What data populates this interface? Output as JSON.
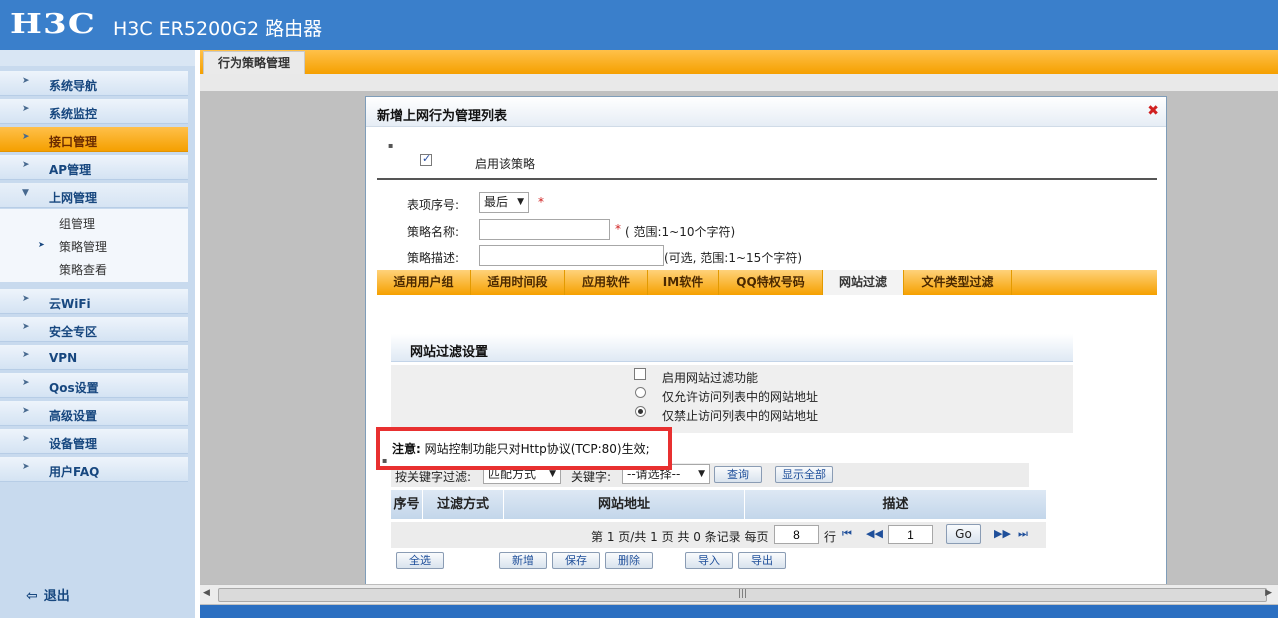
{
  "app": {
    "logo": "H3C",
    "title": "H3C ER5200G2 路由器"
  },
  "sidebar": {
    "items": [
      {
        "label": "系统导航"
      },
      {
        "label": "系统监控"
      },
      {
        "label": "接口管理"
      },
      {
        "label": "AP管理"
      },
      {
        "label": "上网管理"
      },
      {
        "label": "云WiFi"
      },
      {
        "label": "安全专区"
      },
      {
        "label": "VPN"
      },
      {
        "label": "Qos设置"
      },
      {
        "label": "高级设置"
      },
      {
        "label": "设备管理"
      },
      {
        "label": "用户FAQ"
      }
    ],
    "subitems": [
      {
        "label": "组管理"
      },
      {
        "label": "策略管理"
      },
      {
        "label": "策略查看"
      }
    ],
    "logout": "退出"
  },
  "main": {
    "tab": "行为策略管理"
  },
  "dialog": {
    "title": "新增上网行为管理列表",
    "enable_label": "启用该策略",
    "enable_checked": true,
    "order_label": "表项序号:",
    "order_value": "最后",
    "required_mark": "*",
    "name_label": "策略名称:",
    "name_value": "",
    "name_hint": "( 范围:1~10个字符)",
    "desc_label": "策略描述:",
    "desc_value": "",
    "desc_hint": "(可选, 范围:1~15个字符)",
    "tabs": [
      {
        "label": "适用用户组"
      },
      {
        "label": "适用时间段"
      },
      {
        "label": "应用软件"
      },
      {
        "label": "IM软件"
      },
      {
        "label": "QQ特权号码"
      },
      {
        "label": "网站过滤"
      },
      {
        "label": "文件类型过滤"
      }
    ],
    "selected_tab": "网站过滤",
    "filter": {
      "section_title": "网站过滤设置",
      "enable_label": "启用网站过滤功能",
      "enable_checked": false,
      "allow_label": "仅允许访问列表中的网站地址",
      "deny_label": "仅禁止访问列表中的网站地址",
      "selected_mode": "deny"
    },
    "notice": {
      "prefix": "注意:",
      "text": "网站控制功能只对Http协议(TCP:80)生效;"
    },
    "search": {
      "keyword_filter_label": "按关键字过滤:",
      "match_mode": "匹配方式",
      "keyword_label": "关键字:",
      "keyword_placeholder": "--请选择--",
      "query_btn": "查询",
      "show_all_btn": "显示全部"
    },
    "table": {
      "columns": [
        "序号",
        "过滤方式",
        "网站地址",
        "描述"
      ],
      "rows": []
    },
    "pager": {
      "text": "第 1 页/共 1 页 共 0 条记录 每页",
      "per_page": "8",
      "row_unit": "行",
      "page_input": "1",
      "go": "Go"
    },
    "buttons": {
      "select_all": "全选",
      "add": "新增",
      "save": "保存",
      "delete": "删除",
      "import": "导入",
      "export": "导出"
    }
  },
  "colors": {
    "header_blue": "#3a7fcb",
    "active_orange": "#f5a000",
    "notice_red": "#e83030"
  }
}
